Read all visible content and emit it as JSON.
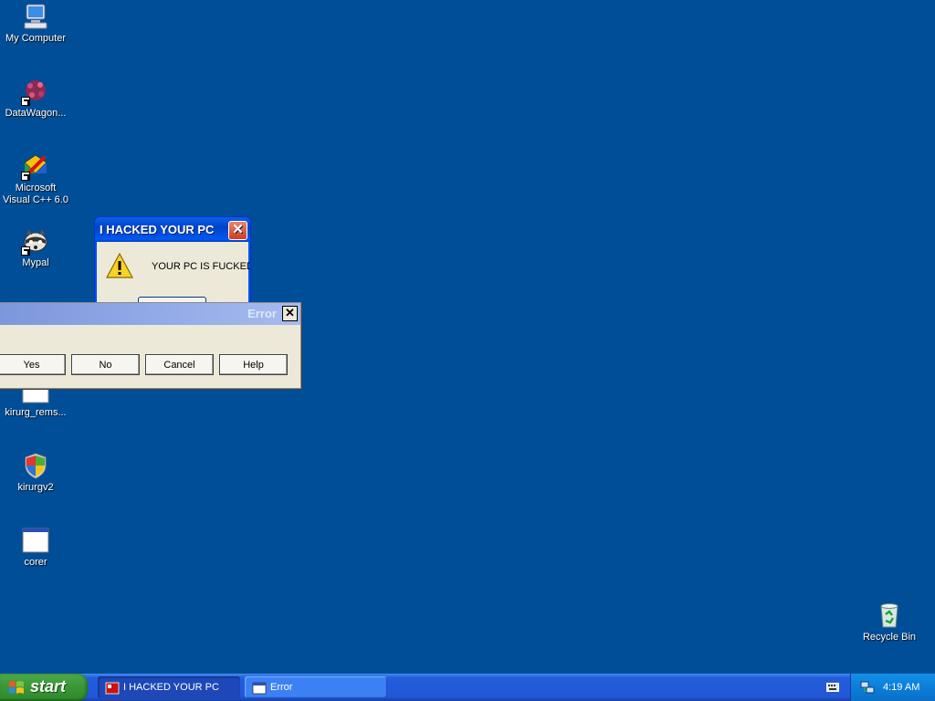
{
  "desktop": {
    "icons": [
      {
        "label": "My Computer",
        "icon": "my-computer-icon"
      },
      {
        "label": "DataWagon...",
        "icon": "datawagon-icon"
      },
      {
        "label": "Microsoft Visual C++ 6.0",
        "icon": "visual-cpp-icon"
      },
      {
        "label": "Mypal",
        "icon": "mypal-icon"
      },
      {
        "label": "kirurg_rems...",
        "icon": "file-icon"
      },
      {
        "label": "kirurgv2",
        "icon": "shield-icon"
      },
      {
        "label": "corer",
        "icon": "application-window-icon"
      },
      {
        "label": "Recycle Bin",
        "icon": "recycle-bin-icon"
      }
    ]
  },
  "hacked_dialog": {
    "title": "I HACKED YOUR PC",
    "message": "YOUR PC IS FUCKED",
    "close_label": "✕"
  },
  "error_dialog": {
    "title": "Error",
    "close_label": "✕",
    "buttons": [
      "Yes",
      "No",
      "Cancel",
      "Help"
    ]
  },
  "taskbar": {
    "start_label": "start",
    "tasks": [
      {
        "label": "I HACKED YOUR PC",
        "state": "active"
      },
      {
        "label": "Error",
        "state": "inactive"
      }
    ],
    "clock": "4:19 AM"
  },
  "colors": {
    "desktop_background": "#004e98",
    "taskbar_blue": "#245edb",
    "start_green": "#3c9a39"
  }
}
